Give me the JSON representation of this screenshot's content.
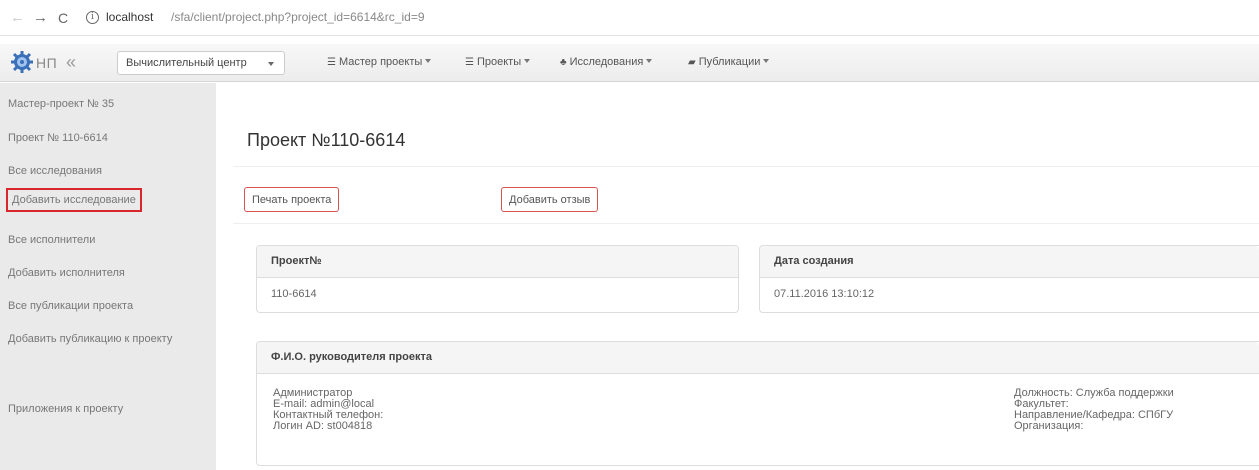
{
  "browser": {
    "back": "←",
    "forward": "→",
    "reload": "C",
    "info": "i",
    "url_host": "localhost",
    "url_path": "/sfa/client/project.php?project_id=6614&rc_id=9"
  },
  "navbar": {
    "logo_text": "НП",
    "collapse": "«",
    "center_select": "Вычислительный центр",
    "menus": [
      {
        "label": "Мастер проекты",
        "icon": "list-icon"
      },
      {
        "label": "Проекты",
        "icon": "list-icon"
      },
      {
        "label": "Исследования",
        "icon": "sitemap-icon"
      },
      {
        "label": "Публикации",
        "icon": "book-icon"
      }
    ]
  },
  "sidebar": {
    "items": [
      "Мастер-проект № 35",
      "Проект № 110-6614",
      "Все исследования",
      "Добавить исследование",
      "Все исполнители",
      "Добавить исполнителя",
      "Все публикации проекта",
      "Добавить публикацию к проекту",
      "Приложения к проекту"
    ],
    "highlighted": "Добавить исследование",
    "highlight_color": "#d9262d"
  },
  "main": {
    "title": "Проект №110-6614",
    "buttons": {
      "print": "Печать проекта",
      "review": "Добавить отзыв"
    },
    "project_panel": {
      "heading": "Проект№",
      "value": "110-6614"
    },
    "date_panel": {
      "heading": "Дата создания",
      "value": "07.11.2016 13:10:12"
    },
    "lead_panel": {
      "heading": "Ф.И.О. руководителя проекта",
      "left": [
        "Администратор",
        "E-mail: admin@local",
        "Контактный телефон:",
        "Логин AD: st004818"
      ],
      "right": [
        "Должность: Служба поддержки",
        "Факультет:",
        "Направление/Кафедра: СПбГУ",
        "Организация:"
      ]
    }
  }
}
